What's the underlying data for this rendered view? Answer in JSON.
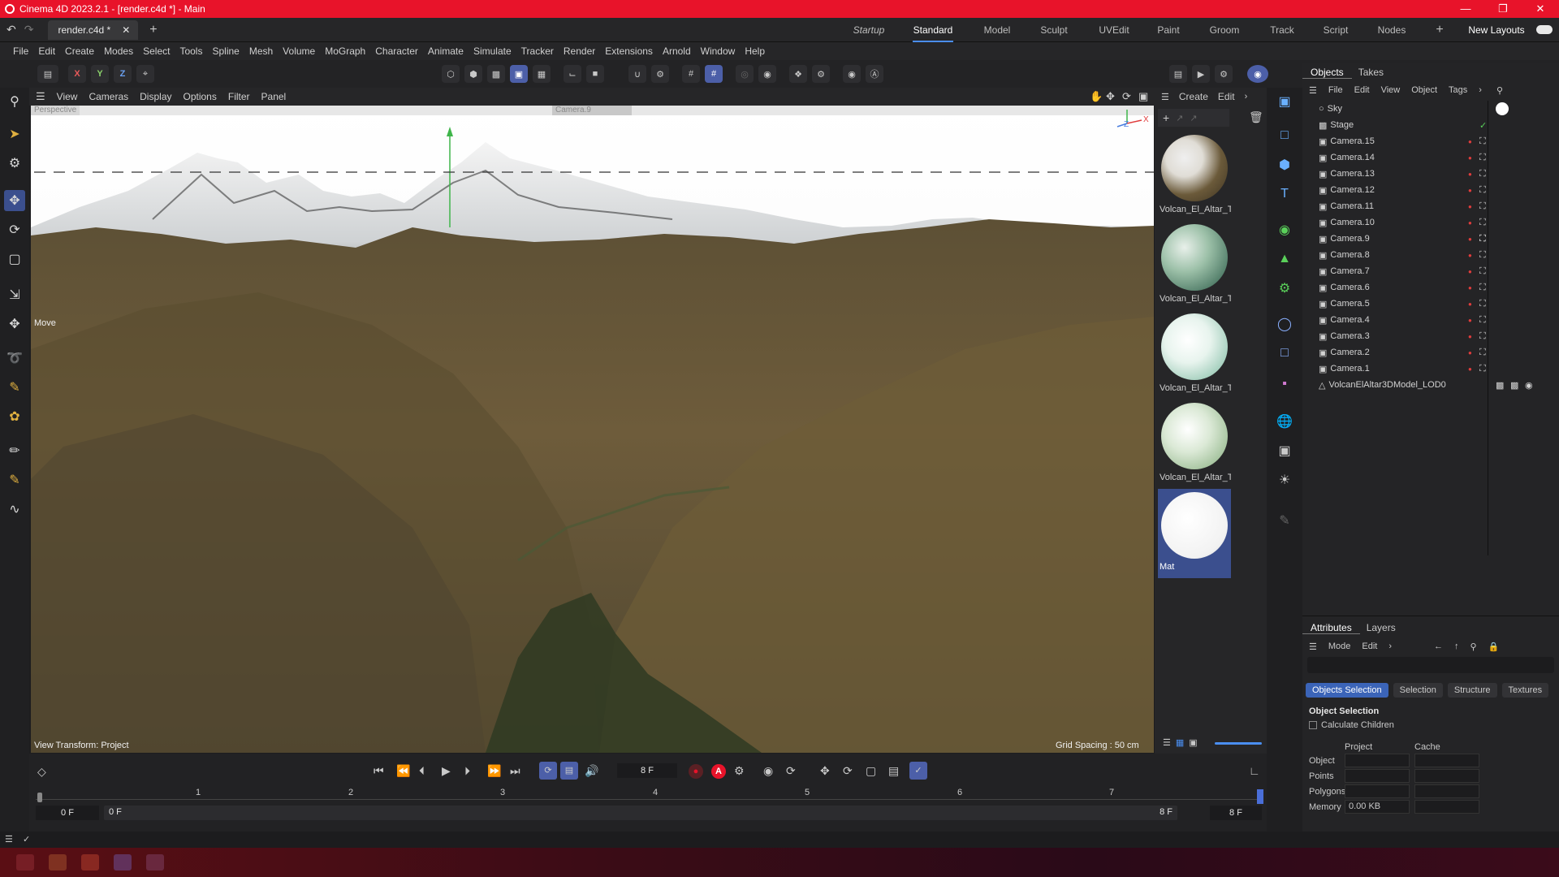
{
  "window": {
    "title": "Cinema 4D 2023.2.1 - [render.c4d *] - Main"
  },
  "doc_tab": {
    "label": "render.c4d *"
  },
  "layouts": {
    "items": [
      "Startup",
      "Standard",
      "Model",
      "Sculpt",
      "UVEdit",
      "Paint",
      "Groom",
      "Track",
      "Script",
      "Nodes"
    ],
    "active": "Standard",
    "new_layouts": "New Layouts"
  },
  "menubar": [
    "File",
    "Edit",
    "Create",
    "Modes",
    "Select",
    "Tools",
    "Spline",
    "Mesh",
    "Volume",
    "MoGraph",
    "Character",
    "Animate",
    "Simulate",
    "Tracker",
    "Render",
    "Extensions",
    "Arnold",
    "Window",
    "Help"
  ],
  "axis_lock": [
    "X",
    "Y",
    "Z"
  ],
  "viewport": {
    "menu": [
      "View",
      "Cameras",
      "Display",
      "Options",
      "Filter",
      "Panel"
    ],
    "view_label": "Perspective",
    "camera_label": "Camera.9",
    "tool_label": "Move",
    "view_transform": "View Transform: Project",
    "grid_spacing": "Grid Spacing : 50 cm",
    "axis_x": "X",
    "axis_z": "Z"
  },
  "materials": {
    "menu": [
      "Create",
      "Edit"
    ],
    "items": [
      {
        "label": "Volcan_El_Altar_Te",
        "color": "#6b5a3a"
      },
      {
        "label": "Volcan_El_Altar_Te",
        "color": "#7aa08a"
      },
      {
        "label": "Volcan_El_Altar_Te",
        "color": "#c9e3d8"
      },
      {
        "label": "Volcan_El_Altar_Te",
        "color": "#aecba4"
      },
      {
        "label": "Mat",
        "color": "#ffffff"
      }
    ]
  },
  "objects": {
    "tabs": [
      "Objects",
      "Takes"
    ],
    "menu": [
      "File",
      "Edit",
      "View",
      "Object",
      "Tags"
    ],
    "rows": [
      "Sky",
      "Stage",
      "Camera.15",
      "Camera.14",
      "Camera.13",
      "Camera.12",
      "Camera.11",
      "Camera.10",
      "Camera.9",
      "Camera.8",
      "Camera.7",
      "Camera.6",
      "Camera.5",
      "Camera.4",
      "Camera.3",
      "Camera.2",
      "Camera.1",
      "VolcanElAltar3DModel_LOD0"
    ]
  },
  "attributes": {
    "tabs": [
      "Attributes",
      "Layers"
    ],
    "menu": [
      "Mode",
      "Edit"
    ],
    "subtabs": [
      "Objects Selection",
      "Selection",
      "Structure",
      "Textures"
    ],
    "section_title": "Object Selection",
    "checkbox_label": "Calculate Children",
    "col_project": "Project",
    "col_cache": "Cache",
    "rows": [
      {
        "label": "Object",
        "project": "",
        "cache": ""
      },
      {
        "label": "Points",
        "project": "",
        "cache": ""
      },
      {
        "label": "Polygons",
        "project": "",
        "cache": ""
      },
      {
        "label": "Memory",
        "project": "0.00 KB",
        "cache": ""
      }
    ]
  },
  "timeline": {
    "current_frame": "8 F",
    "ruler": [
      "1",
      "2",
      "3",
      "4",
      "5",
      "6",
      "7"
    ],
    "start_frame": "0 F",
    "range_start": "0 F",
    "range_end": "8 F",
    "end_frame": "8 F"
  },
  "colors": {
    "accent": "#4a8ef0",
    "titlebar": "#e8132a",
    "record": "#e8132a"
  }
}
